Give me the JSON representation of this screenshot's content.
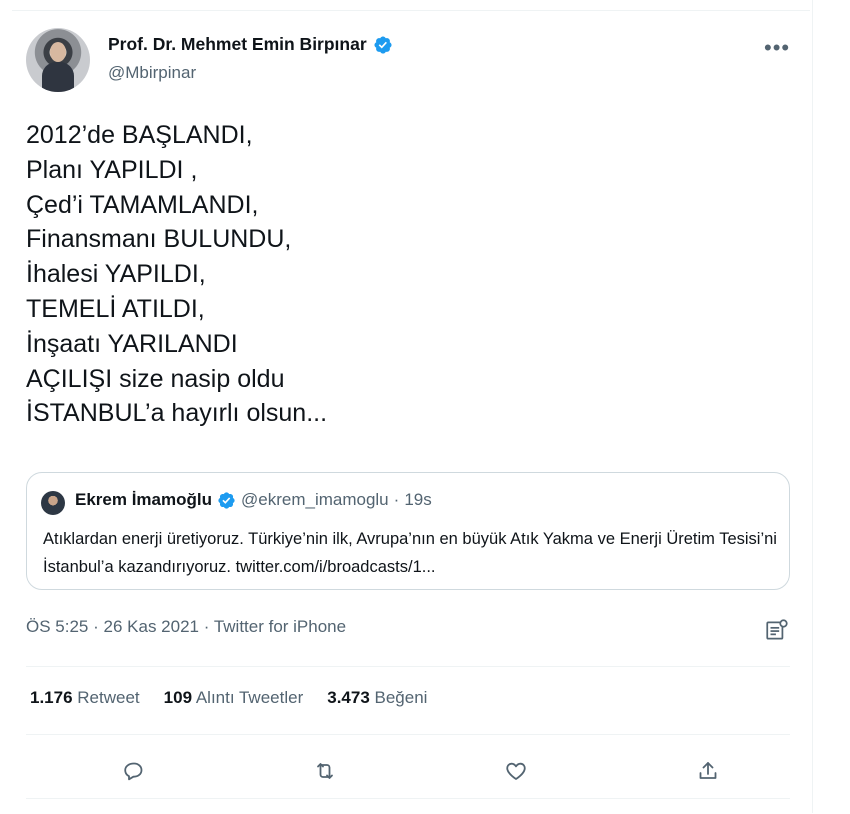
{
  "author": {
    "name": "Prof. Dr. Mehmet Emin Birpınar",
    "handle": "@Mbirpinar"
  },
  "tweet": {
    "lines": [
      "2012’de BAŞLANDI,",
      "Planı YAPILDI ,",
      "Çed’i TAMAMLANDI,",
      "Finansmanı BULUNDU,",
      "İhalesi YAPILDI,",
      "TEMELİ ATILDI,",
      "İnşaatı YARILANDI",
      "AÇILIŞI size nasip oldu",
      "İSTANBUL’a hayırlı olsun..."
    ]
  },
  "quote": {
    "name": "Ekrem İmamoğlu",
    "handle": "@ekrem_imamoglu",
    "separator": "·",
    "time": "19s",
    "text": "Atıklardan enerji üretiyoruz. Türkiye’nin ilk, Avrupa’nın en büyük Atık Yakma ve Enerji Üretim Tesisi’ni İstanbul’a kazandırıyoruz. twitter.com/i/broadcasts/1..."
  },
  "meta": {
    "time": "ÖS 5:25",
    "separator": "·",
    "date": "26 Kas 2021",
    "source": "Twitter for iPhone"
  },
  "stats": {
    "retweets_count": "1.176",
    "retweets_label": "Retweet",
    "quotes_count": "109",
    "quotes_label": "Alıntı Tweetler",
    "likes_count": "3.473",
    "likes_label": "Beğeni"
  },
  "icons": {
    "more": "more-dots-icon",
    "verified": "verified-badge-icon",
    "analytics": "analytics-icon",
    "reply": "reply-icon",
    "retweet": "retweet-icon",
    "like": "heart-icon",
    "share": "share-icon"
  },
  "colors": {
    "verified": "#1d9bf0",
    "secondary_text": "#536471",
    "primary_text": "#0f1419",
    "border": "#cfd9de"
  }
}
